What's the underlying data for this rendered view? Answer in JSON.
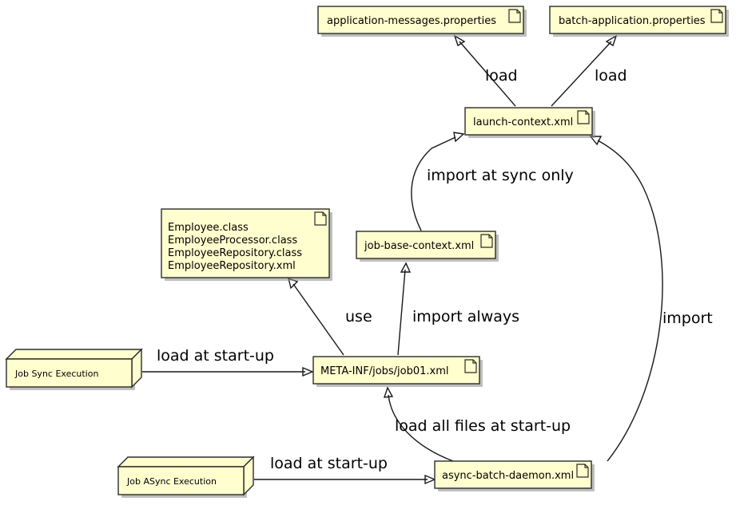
{
  "diagram": {
    "type": "component-deployment-diagram",
    "background": "#FFFFFF",
    "node_fill": "#FEFECE",
    "node_border": "#2B2B2B",
    "edge_color": "#181818",
    "artifacts": [
      {
        "id": "application-messages",
        "label": "application-messages.properties",
        "icon": "document-icon"
      },
      {
        "id": "batch-application",
        "label": "batch-application.properties",
        "icon": "document-icon"
      },
      {
        "id": "launch-context",
        "label": "launch-context.xml",
        "icon": "document-icon"
      },
      {
        "id": "employee-classes",
        "label": "Employee.class\nEmployeeProcessor.class\nEmployeeRepository.class\nEmployeeRepository.xml",
        "lines": [
          "Employee.class",
          "EmployeeProcessor.class",
          "EmployeeRepository.class",
          "EmployeeRepository.xml"
        ],
        "icon": "document-icon"
      },
      {
        "id": "job-base-context",
        "label": "job-base-context.xml",
        "icon": "document-icon"
      },
      {
        "id": "job01",
        "label": "META-INF/jobs/job01.xml",
        "icon": "document-icon"
      },
      {
        "id": "async-batch-daemon",
        "label": "async-batch-daemon.xml",
        "icon": "document-icon"
      }
    ],
    "nodes": [
      {
        "id": "job-sync-execution",
        "label": "Job Sync Execution",
        "shape": "node-3d"
      },
      {
        "id": "job-async-execution",
        "label": "Job ASync Execution",
        "shape": "node-3d"
      }
    ],
    "edges": [
      {
        "id": "e1",
        "from": "launch-context",
        "to": "application-messages",
        "label": "load"
      },
      {
        "id": "e2",
        "from": "launch-context",
        "to": "batch-application",
        "label": "load"
      },
      {
        "id": "e3",
        "from": "job-base-context",
        "to": "launch-context",
        "label": "import at sync only"
      },
      {
        "id": "e4",
        "from": "async-batch-daemon",
        "to": "launch-context",
        "label": "import"
      },
      {
        "id": "e5",
        "from": "job01",
        "to": "employee-classes",
        "label": "use"
      },
      {
        "id": "e6",
        "from": "job01",
        "to": "job-base-context",
        "label": "import always"
      },
      {
        "id": "e7",
        "from": "job-sync-execution",
        "to": "job01",
        "label": "load at start-up"
      },
      {
        "id": "e8",
        "from": "job-async-execution",
        "to": "async-batch-daemon",
        "label": "load at start-up"
      },
      {
        "id": "e9",
        "from": "async-batch-daemon",
        "to": "job01",
        "label": "load all files at start-up"
      }
    ]
  }
}
